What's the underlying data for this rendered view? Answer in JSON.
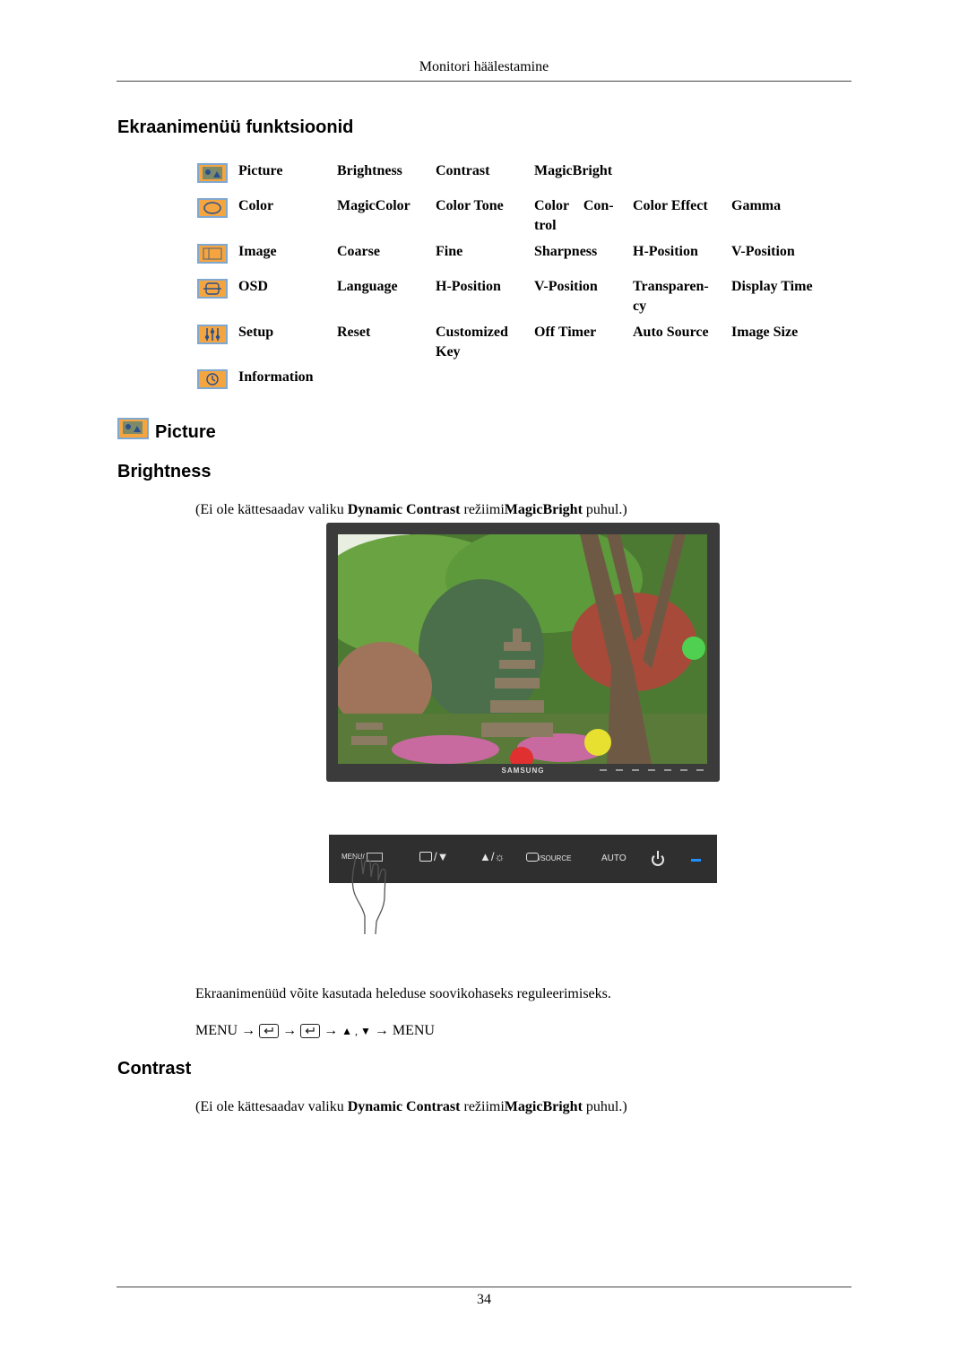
{
  "header": {
    "title": "Monitori häälestamine"
  },
  "section_title": "Ekraanimenüü funktsioonid",
  "menu": [
    {
      "icon": "picture-icon",
      "cells": [
        "Picture",
        "Brightness",
        "Contrast",
        "MagicBright",
        "",
        ""
      ]
    },
    {
      "icon": "color-icon",
      "cells": [
        "Color",
        "MagicColor",
        "Color Tone",
        "Color    Con-\ntrol",
        "Color Effect",
        "Gamma"
      ]
    },
    {
      "icon": "image-icon",
      "cells": [
        "Image",
        "Coarse",
        "Fine",
        "Sharpness",
        "H-Position",
        "V-Position"
      ]
    },
    {
      "icon": "osd-icon",
      "cells": [
        "OSD",
        "Language",
        "H-Position",
        "V-Position",
        "Transparen-\ncy",
        "Display Time"
      ]
    },
    {
      "icon": "setup-icon",
      "cells": [
        "Setup",
        "Reset",
        "Customized\nKey",
        "Off Timer",
        "Auto Source",
        "Image Size"
      ]
    },
    {
      "icon": "information-icon",
      "cells": [
        "Information",
        "",
        "",
        "",
        "",
        ""
      ]
    }
  ],
  "picture_heading": "Picture",
  "brightness": {
    "heading": "Brightness",
    "note": {
      "pre": "(Ei ole kättesaadav valiku ",
      "bold1": "Dynamic Contrast",
      "mid": " režiimi",
      "bold2": "MagicBright",
      "post": " puhul.)"
    },
    "monitor_brand": "SAMSUNG",
    "button_panel": {
      "menu": "MENU/",
      "down": "/▼",
      "up": "▲/☼",
      "source": "/SOURCE",
      "auto": "AUTO"
    },
    "instruction": "Ekraanimenüüd võite kasutada heleduse soovikohaseks reguleerimiseks.",
    "path": {
      "start": "MENU →",
      "arrow1": "→",
      "arrow2": "→",
      "keys": "▲ , ▼",
      "end": "→ MENU"
    }
  },
  "contrast": {
    "heading": "Contrast",
    "note": {
      "pre": "(Ei ole kättesaadav valiku ",
      "bold1": "Dynamic Contrast",
      "mid": " režiimi",
      "bold2": "MagicBright",
      "post": " puhul.)"
    }
  },
  "footer": {
    "page_number": "34"
  }
}
